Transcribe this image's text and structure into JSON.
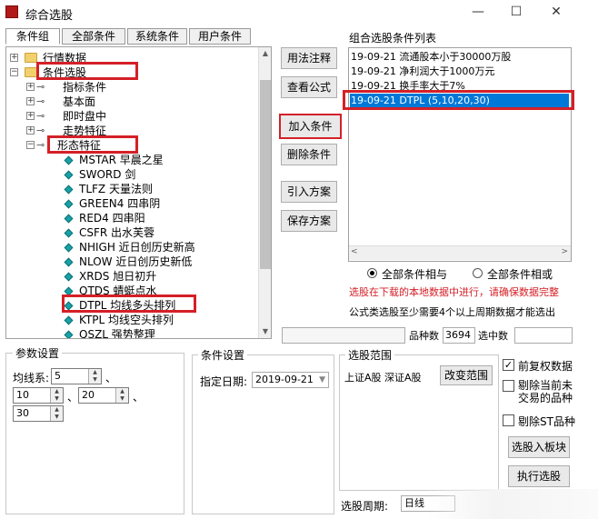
{
  "window": {
    "title": "综合选股",
    "minimize": "—",
    "maximize": "☐",
    "close": "✕"
  },
  "tabs": [
    "条件组",
    "全部条件",
    "系统条件",
    "用户条件"
  ],
  "tree": {
    "nodes": [
      {
        "label": "行情数据",
        "pm": "+"
      },
      {
        "label": "条件选股",
        "pm": "−"
      },
      {
        "label": "指标条件",
        "pm": "+"
      },
      {
        "label": "基本面",
        "pm": "+"
      },
      {
        "label": "即时盘中",
        "pm": "+"
      },
      {
        "label": "走势特征",
        "pm": "+"
      },
      {
        "label": "形态特征",
        "pm": "−"
      },
      {
        "label": "MSTAR 早晨之星"
      },
      {
        "label": "SWORD 剑"
      },
      {
        "label": "TLFZ 天量法则"
      },
      {
        "label": "GREEN4 四串阴"
      },
      {
        "label": "RED4 四串阳"
      },
      {
        "label": "CSFR 出水芙蓉"
      },
      {
        "label": "NHIGH 近日创历史新高"
      },
      {
        "label": "NLOW 近日创历史新低"
      },
      {
        "label": "XRDS 旭日初升"
      },
      {
        "label": "QTDS 蜻蜓点水"
      },
      {
        "label": "DTPL 均线多头排列"
      },
      {
        "label": "KTPL 均线空头排列"
      },
      {
        "label": "QSZL 强势整理"
      }
    ]
  },
  "buttons": {
    "usage": "用法注释",
    "formula": "查看公式",
    "add": "加入条件",
    "delete": "删除条件",
    "import": "引入方案",
    "save": "保存方案",
    "range": "改变范围",
    "to_block": "选股入板块",
    "run": "执行选股"
  },
  "conditions": {
    "header": "组合选股条件列表",
    "items": [
      "19-09-21 流通股本小于30000万股",
      "19-09-21 净利润大于1000万元",
      "19-09-21 换手率大于7%",
      "19-09-21 DTPL (5,10,20,30)"
    ]
  },
  "logic": {
    "and_label": "全部条件相与",
    "or_label": "全部条件相或"
  },
  "warnings": {
    "red": "选股在下载的本地数据中进行，请确保数据完整",
    "formula": "公式类选股至少需要4个以上周期数据才能选出"
  },
  "counts": {
    "total_label": "品种数",
    "total_value": "3694",
    "selected_label": "选中数"
  },
  "params": {
    "group_title": "参数设置",
    "ma_label": "均线系:",
    "values": [
      "5",
      "10",
      "20",
      "30"
    ],
    "sep": "、"
  },
  "cond_settings": {
    "title": "条件设置",
    "date_label": "指定日期:",
    "date_value": "2019-09-21"
  },
  "scope": {
    "title": "选股范围",
    "value": "上证A股 深证A股"
  },
  "options": {
    "fq": "前复权数据",
    "exclude_suspended_1": "剔除当前未",
    "exclude_suspended_2": "交易的品种",
    "exclude_st": "剔除ST品种"
  },
  "period": {
    "label": "选股周期:",
    "value": "日线"
  },
  "colors": {
    "accent": "#0078d7",
    "warning": "#d42027"
  }
}
